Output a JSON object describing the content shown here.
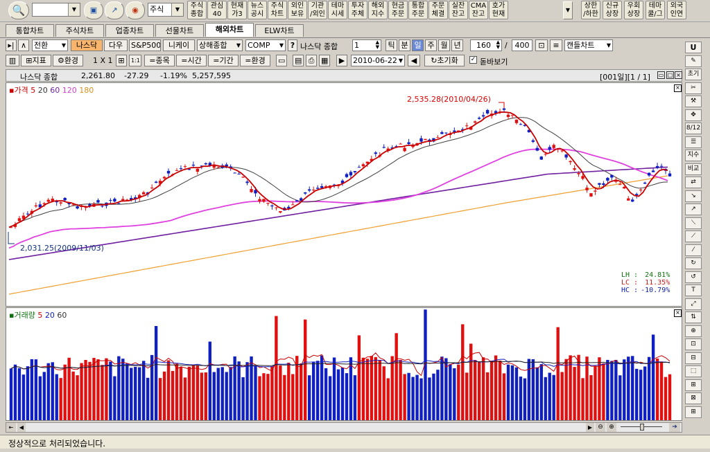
{
  "toolbar": {
    "combo_value": "",
    "stock_select": "주식",
    "buttons": [
      "주식\n종합",
      "관심\n40",
      "현재\n가3",
      "뉴스\n공시",
      "주식\n차트",
      "외인\n보유",
      "기관\n/외인",
      "테마\n시세",
      "투자\n주체",
      "해외\n지수",
      "현금\n주문",
      "통합\n주문",
      "주문\n체결",
      "실잔\n잔고",
      "CMA\n잔고",
      "호가\n현재"
    ],
    "right_buttons": [
      "상한\n/하한",
      "신규\n상장",
      "우회\n상장",
      "테마\n쿨/그",
      "외국\n인연"
    ]
  },
  "tabs": [
    "통합차트",
    "주식차트",
    "업종차트",
    "선물차트",
    "해외차트",
    "ELW차트"
  ],
  "active_tab": "해외차트",
  "row1": {
    "mode": "전환",
    "markets": [
      "나스닥",
      "다우",
      "S&P500",
      "니케이",
      "상해종합"
    ],
    "symbol": "COMP",
    "symbol_name": "나스닥 종합",
    "period_value": "1",
    "period_buttons": [
      "틱",
      "분",
      "일",
      "주",
      "월",
      "년"
    ],
    "count": "160",
    "count_total": "400",
    "chart_type": "캔들차트"
  },
  "row2": {
    "indicator": "지표",
    "env": "환경",
    "layout": "1 X 1",
    "eq_buttons": [
      "=종목",
      "=시간",
      "=기간",
      "=환경"
    ],
    "date": "2010-06-22",
    "reset": "초기화",
    "magnifier": "돋바보기"
  },
  "info": {
    "name": "나스닥 종합",
    "price": "2,261.80",
    "change": "-27.29",
    "pct": "-1.19%",
    "volume": "5,257,595",
    "page": "[001일][1 / 1]"
  },
  "price_legend": {
    "label": "가격",
    "items": [
      "5",
      "20",
      "60",
      "120",
      "180"
    ]
  },
  "volume_legend": {
    "label": "거래량",
    "items": [
      "5",
      "20",
      "60"
    ]
  },
  "annotations": {
    "high": "2,535.28(2010/04/26)",
    "low": "2,031.25(2009/11/03)",
    "lh_label": "LH :",
    "lh": "24.81%",
    "lc_label": "LC :",
    "lc": "11.35%",
    "hc_label": "HC :",
    "hc": "-10.79%"
  },
  "right_toolbar": [
    "U",
    "초기",
    "8/12",
    "지수",
    "비교"
  ],
  "status": "정상적으로 처리되었습니다.",
  "colors": {
    "up": "#e01010",
    "down": "#1020c0",
    "ma5": "#c80000",
    "ma20": "#404040",
    "ma60": "#7020a0",
    "ma120": "#e040e0",
    "ma180": "#f0a030"
  },
  "chart_data": {
    "type": "line",
    "title": "나스닥 종합",
    "xlabel": "",
    "ylabel": "",
    "high_point": {
      "date": "2010/04/26",
      "value": 2535.28
    },
    "low_point": {
      "date": "2009/11/03",
      "value": 2031.25
    },
    "last_close": 2261.8
  }
}
